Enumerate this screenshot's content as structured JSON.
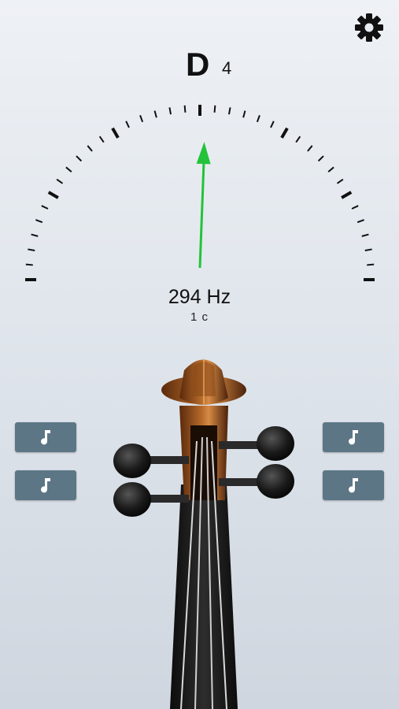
{
  "header": {
    "settings_icon": "gear-icon"
  },
  "tuner": {
    "note": "D",
    "octave": "4",
    "frequency": "294 Hz",
    "cents": "1 c",
    "cents_value": 1,
    "needle_color": "#22c33a"
  },
  "string_buttons": {
    "icon": "music-note-icon",
    "count": 4
  },
  "colors": {
    "button_bg": "#5d7686",
    "tick": "#111111"
  }
}
